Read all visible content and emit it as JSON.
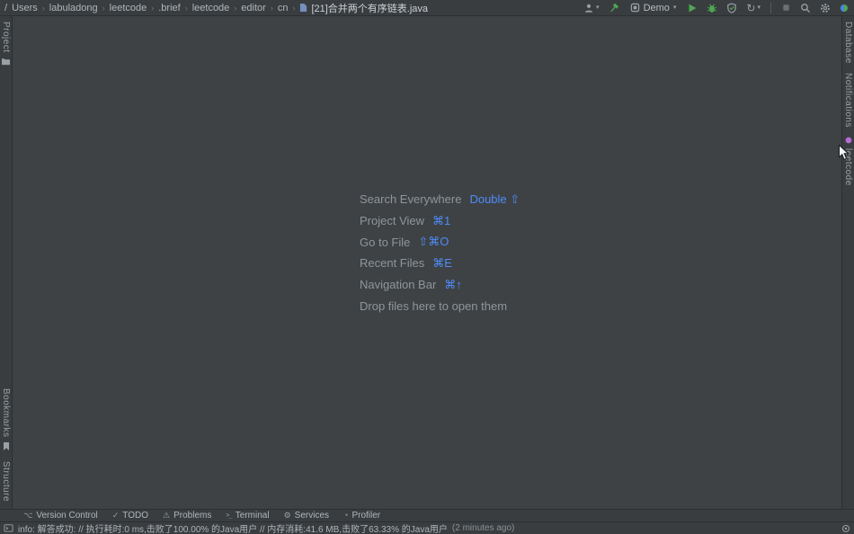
{
  "colors": {
    "accent_blue": "#4f8cf7",
    "accent_green": "#4fa753",
    "chrome_bg": "#393d40",
    "editor_bg": "#3e4245",
    "leetcode_dot": "#b66bd6"
  },
  "breadcrumbs": {
    "root": "/",
    "separator": "›",
    "items": [
      "Users",
      "labuladong",
      "leetcode",
      ".brief",
      "leetcode",
      "editor",
      "cn"
    ],
    "file": "[21]合并两个有序链表.java"
  },
  "toolbar": {
    "run_config": "Demo"
  },
  "icons": {
    "dropdown_arrow": "▾",
    "rerun": "↻",
    "version_control": "⌥",
    "todo": "✓",
    "problems": "⚠",
    "terminal": ">_",
    "services": "⚙",
    "profiler": "◔"
  },
  "stripes": {
    "left_top": [
      {
        "label": "Project"
      }
    ],
    "left_bottom": [
      {
        "label": "Bookmarks"
      },
      {
        "label": "Structure"
      }
    ],
    "right_top": [
      {
        "label": "Database"
      },
      {
        "label": "Notifications"
      },
      {
        "label": "leetcode"
      }
    ]
  },
  "editor": {
    "hints": [
      {
        "label": "Search Everywhere",
        "shortcut": "Double ⇧"
      },
      {
        "label": "Project View",
        "shortcut": "⌘1"
      },
      {
        "label": "Go to File",
        "shortcut": "⇧⌘O"
      },
      {
        "label": "Recent Files",
        "shortcut": "⌘E"
      },
      {
        "label": "Navigation Bar",
        "shortcut": "⌘↑"
      }
    ],
    "drop_hint": "Drop files here to open them"
  },
  "tool_buttons": [
    {
      "label": "Version Control"
    },
    {
      "label": "TODO"
    },
    {
      "label": "Problems"
    },
    {
      "label": "Terminal"
    },
    {
      "label": "Services"
    },
    {
      "label": "Profiler"
    }
  ],
  "status_bar": {
    "message": "info: 解答成功: // 执行耗时:0 ms,击败了100.00% 的Java用户 // 内存消耗:41.6 MB,击败了63.33% 的Java用户",
    "time": "(2 minutes ago)"
  }
}
